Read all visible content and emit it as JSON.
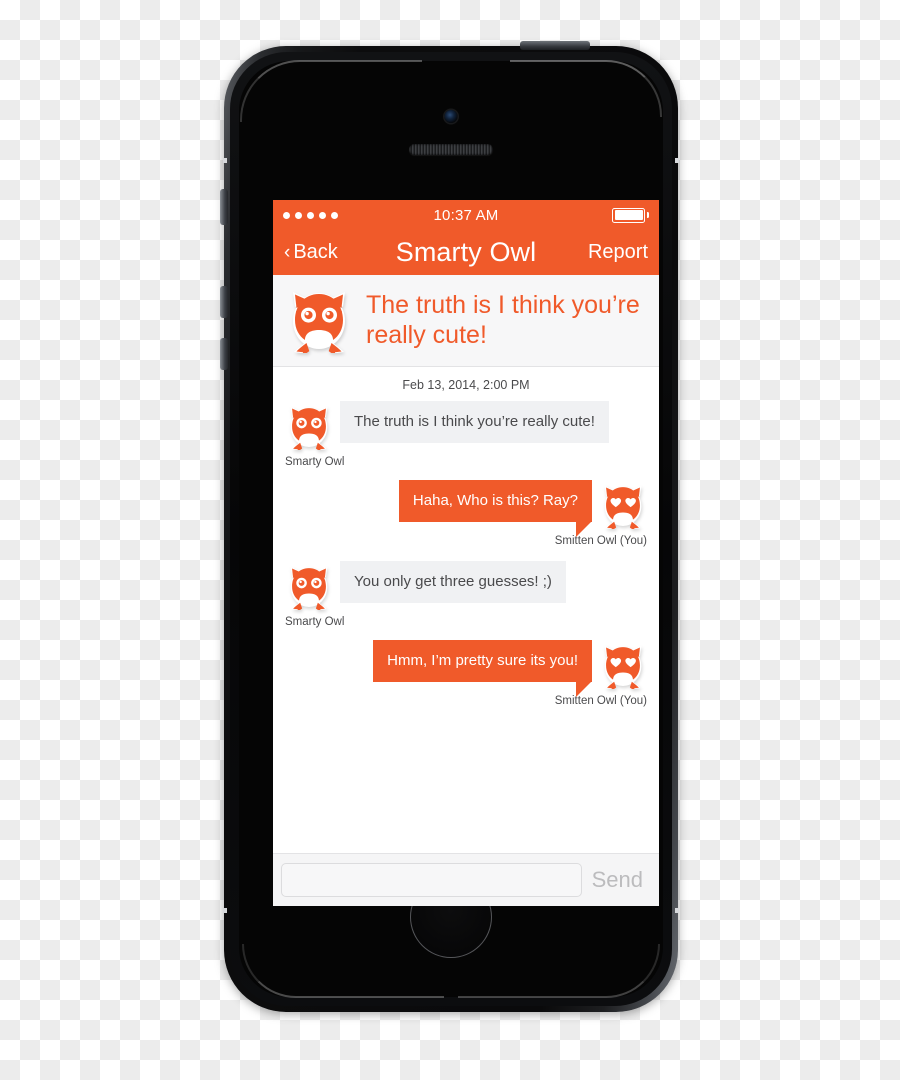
{
  "status_bar": {
    "signal_dots": 5,
    "time": "10:37 AM",
    "battery_icon": "battery-full-icon"
  },
  "nav_bar": {
    "back_label": "Back",
    "back_icon": "chevron-left-icon",
    "title": "Smarty Owl",
    "report_label": "Report"
  },
  "featured": {
    "avatar_icon": "owl-glasses-avatar-icon",
    "text": "The truth is I think you’re really cute!"
  },
  "conversation": {
    "timestamp": "Feb 13, 2014, 2:00 PM",
    "messages": [
      {
        "direction": "incoming",
        "text": "The truth is I  think you’re really cute!",
        "sender": "Smarty Owl",
        "avatar_icon": "owl-glasses-avatar-icon"
      },
      {
        "direction": "outgoing",
        "text": "Haha, Who is this? Ray?",
        "sender": "Smitten  Owl (You)",
        "avatar_icon": "owl-heart-eyes-avatar-icon"
      },
      {
        "direction": "incoming",
        "text": "You only get three guesses! ;)",
        "sender": "Smarty Owl",
        "avatar_icon": "owl-glasses-avatar-icon"
      },
      {
        "direction": "outgoing",
        "text": "Hmm, I’m pretty sure its you!",
        "sender": "Smitten  Owl (You)",
        "avatar_icon": "owl-heart-eyes-avatar-icon"
      }
    ]
  },
  "composer": {
    "input_value": "",
    "input_placeholder": "",
    "send_label": "Send"
  },
  "colors": {
    "accent_orange": "#F05A2A",
    "incoming_bubble": "#F0F1F3",
    "featured_bg": "#F7F7F8",
    "text_dark": "#4A4A4C",
    "send_disabled": "#BCBCBE"
  },
  "device": {
    "camera_icon": "front-camera-icon",
    "speaker_icon": "earpiece-speaker-icon",
    "home_button_icon": "home-button-icon",
    "mute_switch_icon": "mute-switch-icon",
    "volume_up_icon": "volume-up-button-icon",
    "volume_down_icon": "volume-down-button-icon",
    "power_button_icon": "power-button-icon"
  }
}
